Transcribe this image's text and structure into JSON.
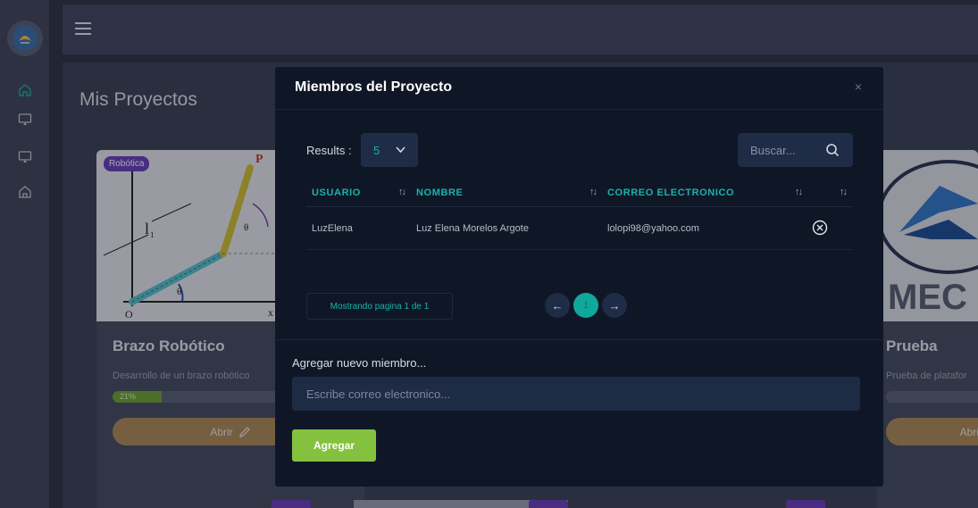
{
  "sidebar": {
    "logo_icon": "lotus-logo-icon",
    "items": [
      {
        "icon": "home-icon"
      },
      {
        "icon": "monitor-icon"
      },
      {
        "icon": "monitor-icon"
      },
      {
        "icon": "home-outline-icon"
      }
    ]
  },
  "topbar": {
    "menu_icon": "hamburger-icon"
  },
  "main": {
    "title": "Mis Proyectos",
    "cards": [
      {
        "category": "Robótica",
        "title": "Brazo Robótico",
        "description": "Desarrollo de un brazo robótico",
        "progress_label": "21%",
        "progress": 21,
        "open_label": "Abrir"
      },
      {
        "logo_text": "MEC",
        "title": "Prueba",
        "description": "Prueba de platafor",
        "open_label": "Abri"
      }
    ]
  },
  "modal": {
    "title": "Miembros del Proyecto",
    "close_label": "×",
    "results_label": "Results :",
    "results_value": "5",
    "search_placeholder": "Buscar...",
    "table": {
      "columns": [
        "USUARIO",
        "NOMBRE",
        "CORREO ELECTRONICO",
        "",
        ""
      ],
      "sort_glyph": "↑↓",
      "rows": [
        {
          "usuario": "LuzElena",
          "nombre": "Luz Elena Morelos Argote",
          "correo": "lolopi98@yahoo.com"
        }
      ]
    },
    "paging_info": "Mostrando pagina 1 de 1",
    "pager": {
      "prev": "←",
      "current": "1",
      "next": "→"
    },
    "add_label": "Agregar nuevo miembro...",
    "add_placeholder": "Escribe correo electronico...",
    "add_button": "Agregar"
  },
  "colors": {
    "accent_teal": "#1bb2a8",
    "accent_green": "#84c13f",
    "modal_bg": "#0f1727",
    "badge_purple": "#6a3fbd"
  }
}
